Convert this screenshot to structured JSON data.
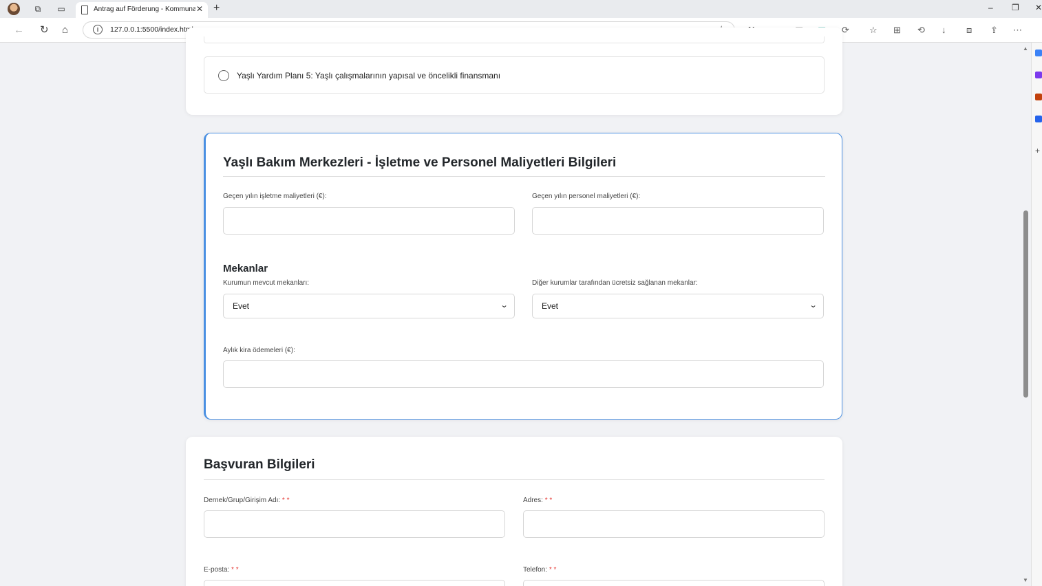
{
  "browser": {
    "tab_title": "Antrag auf Förderung - Kommuna",
    "tab_close": "✕",
    "new_tab": "+",
    "url": "127.0.0.1:5500/index.html",
    "icons": [
      "back-icon",
      "refresh-icon",
      "home-icon",
      "favorite-star-icon",
      "extensions-icon",
      "collections-icon",
      "history-icon",
      "downloads-icon",
      "settings-more-icon"
    ]
  },
  "card1": {
    "option_label": "Yaşlı Yardım Planı 5: Yaşlı çalışmalarının yapısal ve öncelikli finansmanı"
  },
  "elder_care": {
    "heading": "Yaşlı Bakım Merkezleri - İşletme ve Personel Maliyetleri Bilgileri",
    "operating_costs_label": "Geçen yılın işletme maliyetleri (€):",
    "personnel_costs_label": "Geçen yılın personel maliyetleri (€):",
    "operating_costs_value": "",
    "personnel_costs_value": "",
    "premises_heading": "Mekanlar",
    "own_premises_label": "Kurumun mevcut mekanları:",
    "own_premises_value": "Evet",
    "free_premises_label": "Diğer kurumlar tarafından ücretsiz sağlanan mekanlar:",
    "free_premises_value": "Evet",
    "rent_label": "Aylık kira ödemeleri (€):",
    "rent_value": ""
  },
  "applicant": {
    "heading": "Başvuran Bilgileri",
    "name_label": "Dernek/Grup/Girişim Adı: ",
    "address_label": "Adres: ",
    "email_label": "E-posta: ",
    "phone_label": "Telefon: ",
    "required_marker": "* *"
  },
  "colors": {
    "accent_border": "#4a90e2",
    "required": "#e53935",
    "page_bg": "#f1f2f5"
  }
}
